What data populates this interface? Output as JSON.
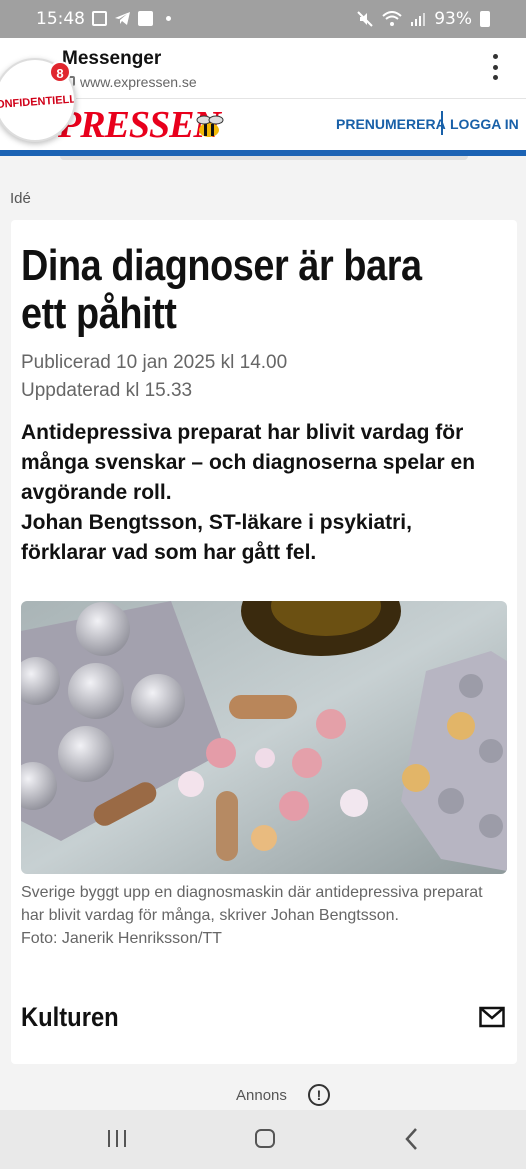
{
  "status_bar": {
    "time": "15:48",
    "battery": "93%",
    "icons_left": [
      "gallery-icon",
      "telegram-icon",
      "check-icon",
      "dot-icon"
    ],
    "icons_right": [
      "mute-icon",
      "wifi-icon",
      "signal-icon",
      "battery-icon"
    ]
  },
  "browser": {
    "title": "Messenger",
    "url": "www.expressen.se",
    "notification_count": "8",
    "chat_head_text": "ONFIDENTIELLT"
  },
  "site": {
    "logo_text": "PRESSEN",
    "subscribe_label": "PRENUMERERA",
    "login_label": "LOGGA IN",
    "brand_color": "#e8001c",
    "link_color": "#1860a8",
    "strip_color": "#1c63b4"
  },
  "article": {
    "category": "Idé",
    "headline": "Dina diagnoser är bara ett påhitt",
    "published": "Publicerad 10 jan 2025 kl 14.00",
    "updated": "Uppdaterad kl 15.33",
    "lead": "Antidepressiva preparat har blivit vardag för många svenskar – och diagnoserna spelar en avgörande roll.\n   Johan Bengtsson, ST-läkare i psykiatri, förklarar vad som har gått fel.",
    "caption": "Sverige byggt upp en diagnosmaskin där antidepressiva preparat har blivit vardag för många, skriver Johan Bengtsson.",
    "photo_credit": "Foto: Janerik Henriksson/TT",
    "section": "Kulturen"
  },
  "ad": {
    "label": "Annons"
  }
}
